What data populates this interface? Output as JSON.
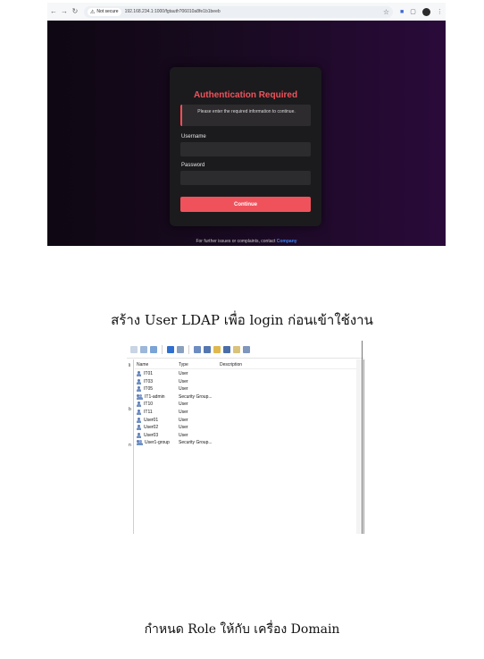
{
  "browser": {
    "nav": {
      "back": "←",
      "forward": "→",
      "reload": "↻"
    },
    "not_secure": "Not secure",
    "url": "192.168.234.1:1000/fgtauth?06010a8fe1b1beeb",
    "star": "☆"
  },
  "auth": {
    "title": "Authentication Required",
    "info": "Please enter the required information to continue.",
    "username_label": "Username",
    "username_value": "",
    "password_label": "Password",
    "password_value": "",
    "continue_label": "Continue",
    "footer_prefix": "For further issues or complaints, contact ",
    "footer_link": "Company",
    "colors": {
      "accent": "#f0525c",
      "card": "#1b1b1d",
      "link": "#3b82f6"
    }
  },
  "caption1": "สร้าง User LDAP เพื่อ login ก่อนเข้าใช้งาน",
  "caption2": "กำหนด Role ให้กับ เครื่อง Domain",
  "ad": {
    "columns": {
      "name": "Name",
      "type": "Type",
      "description": "Description"
    },
    "strip_chars": [
      "li",
      "b",
      "n"
    ],
    "rows": [
      {
        "name": "IT01",
        "type": "User",
        "icon": "user-icon"
      },
      {
        "name": "IT03",
        "type": "User",
        "icon": "user-icon"
      },
      {
        "name": "IT05",
        "type": "User",
        "icon": "user-icon"
      },
      {
        "name": "IT1-admin",
        "type": "Security Group...",
        "icon": "group-icon"
      },
      {
        "name": "IT10",
        "type": "User",
        "icon": "user-icon"
      },
      {
        "name": "IT11",
        "type": "User",
        "icon": "user-icon"
      },
      {
        "name": "User01",
        "type": "User",
        "icon": "user-icon"
      },
      {
        "name": "User02",
        "type": "User",
        "icon": "user-icon"
      },
      {
        "name": "User03",
        "type": "User",
        "icon": "user-icon"
      },
      {
        "name": "User1-group",
        "type": "Security Group...",
        "icon": "group-icon"
      }
    ]
  }
}
